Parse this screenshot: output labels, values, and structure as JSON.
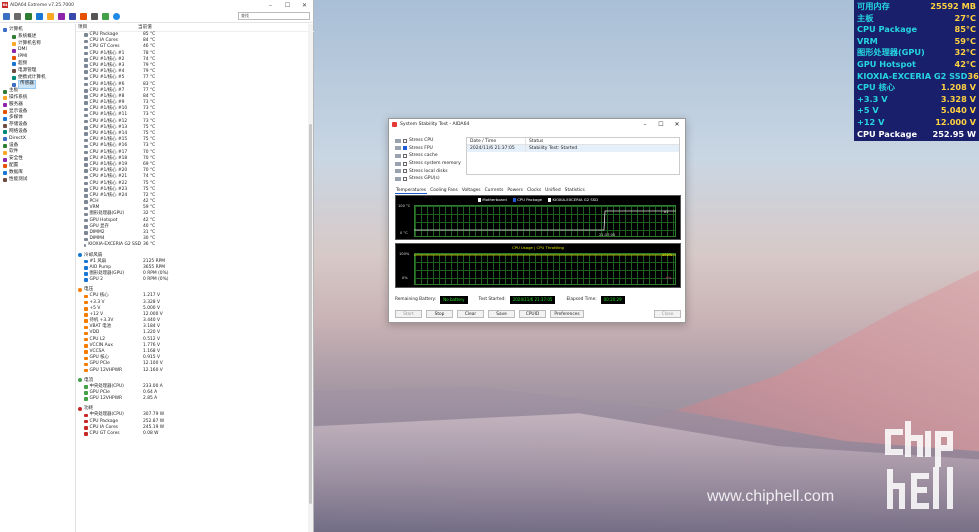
{
  "desktop": {
    "watermark": "www.chiphell.com"
  },
  "aida": {
    "title": "AIDA64 Extreme v7.25.7000",
    "search_placeholder": "查找",
    "tree": [
      {
        "label": "计算机",
        "level": 0
      },
      {
        "label": "系统概述",
        "level": 1
      },
      {
        "label": "计算机名称",
        "level": 1
      },
      {
        "label": "DMI",
        "level": 1
      },
      {
        "label": "IPMI",
        "level": 1
      },
      {
        "label": "超频",
        "level": 1
      },
      {
        "label": "电源管理",
        "level": 1
      },
      {
        "label": "便携式计算机",
        "level": 1
      },
      {
        "label": "传感器",
        "level": 1,
        "selected": true
      },
      {
        "label": "主板",
        "level": 0
      },
      {
        "label": "操作系统",
        "level": 0
      },
      {
        "label": "服务器",
        "level": 0
      },
      {
        "label": "显示设备",
        "level": 0
      },
      {
        "label": "多媒体",
        "level": 0
      },
      {
        "label": "存储设备",
        "level": 0
      },
      {
        "label": "网络设备",
        "level": 0
      },
      {
        "label": "DirectX",
        "level": 0
      },
      {
        "label": "设备",
        "level": 0
      },
      {
        "label": "软件",
        "level": 0
      },
      {
        "label": "安全性",
        "level": 0
      },
      {
        "label": "配置",
        "level": 0
      },
      {
        "label": "数据库",
        "level": 0
      },
      {
        "label": "性能测试",
        "level": 0
      }
    ],
    "col_item": "项目",
    "col_value": "当前值",
    "temps": [
      [
        "CPU Package",
        "85 °C"
      ],
      [
        "CPU IA Cores",
        "84 °C"
      ],
      [
        "CPU GT Cores",
        "46 °C"
      ],
      [
        "CPU #1/核心 #1",
        "78 °C"
      ],
      [
        "CPU #1/核心 #2",
        "74 °C"
      ],
      [
        "CPU #1/核心 #3",
        "79 °C"
      ],
      [
        "CPU #1/核心 #4",
        "79 °C"
      ],
      [
        "CPU #1/核心 #5",
        "77 °C"
      ],
      [
        "CPU #1/核心 #6",
        "83 °C"
      ],
      [
        "CPU #1/核心 #7",
        "77 °C"
      ],
      [
        "CPU #1/核心 #8",
        "84 °C"
      ],
      [
        "CPU #1/核心 #9",
        "73 °C"
      ],
      [
        "CPU #1/核心 #10",
        "73 °C"
      ],
      [
        "CPU #1/核心 #11",
        "73 °C"
      ],
      [
        "CPU #1/核心 #12",
        "73 °C"
      ],
      [
        "CPU #1/核心 #13",
        "75 °C"
      ],
      [
        "CPU #1/核心 #14",
        "75 °C"
      ],
      [
        "CPU #1/核心 #15",
        "75 °C"
      ],
      [
        "CPU #1/核心 #16",
        "73 °C"
      ],
      [
        "CPU #1/核心 #17",
        "70 °C"
      ],
      [
        "CPU #1/核心 #18",
        "70 °C"
      ],
      [
        "CPU #1/核心 #19",
        "69 °C"
      ],
      [
        "CPU #1/核心 #20",
        "70 °C"
      ],
      [
        "CPU #1/核心 #21",
        "74 °C"
      ],
      [
        "CPU #1/核心 #22",
        "75 °C"
      ],
      [
        "CPU #1/核心 #23",
        "75 °C"
      ],
      [
        "CPU #1/核心 #24",
        "72 °C"
      ],
      [
        "PCH",
        "42 °C"
      ],
      [
        "VRM",
        "59 °C"
      ],
      [
        "图形处理器(GPU)",
        "32 °C"
      ],
      [
        "GPU Hotspot",
        "42 °C"
      ],
      [
        "GPU 显存",
        "40 °C"
      ],
      [
        "DIMM2",
        "31 °C"
      ],
      [
        "DIMM4",
        "30 °C"
      ],
      [
        "KIOXIA-EXCERIA G2 SSD",
        "36 °C"
      ]
    ],
    "fans_title": "冷却风扇",
    "fans": [
      [
        "#1 风扇",
        "2125 RPM"
      ],
      [
        "AIO Pump",
        "3655 RPM"
      ],
      [
        "图形处理器(GPU)",
        "0 RPM (0%)"
      ],
      [
        "GPU 2",
        "0 RPM (0%)"
      ]
    ],
    "volt_title": "电压",
    "volts": [
      [
        "CPU 核心",
        "1.217 V"
      ],
      [
        "+3.3 V",
        "3.328 V"
      ],
      [
        "+5 V",
        "5.000 V"
      ],
      [
        "+12 V",
        "12.000 V"
      ],
      [
        "待机 +3.3V",
        "3.440 V"
      ],
      [
        "VBAT 电池",
        "3.184 V"
      ],
      [
        "VDD",
        "1.220 V"
      ],
      [
        "CPU L2",
        "0.512 V"
      ],
      [
        "VCCIN Aux",
        "1.776 V"
      ],
      [
        "VCCSA",
        "1.168 V"
      ],
      [
        "GPU 核心",
        "0.915 V"
      ],
      [
        "GPU PCIe",
        "12.100 V"
      ],
      [
        "GPU 12VHPWR",
        "12.160 V"
      ]
    ],
    "curr_title": "电流",
    "currents": [
      [
        "中央处理器(CPU)",
        "233.00 A"
      ],
      [
        "GPU PCIe",
        "0.64 A"
      ],
      [
        "GPU 12VHPWR",
        "2.85 A"
      ]
    ],
    "power_title": "功耗",
    "powers": [
      [
        "中央处理器(CPU)",
        "307.79 W"
      ],
      [
        "CPU Package",
        "252.87 W"
      ],
      [
        "CPU IA Cores",
        "245.19 W"
      ],
      [
        "CPU GT Cores",
        "0.08 W"
      ]
    ]
  },
  "stability": {
    "title": "System Stability Test - AIDA64",
    "stress_items": [
      {
        "label": "Stress CPU",
        "checked": false
      },
      {
        "label": "Stress FPU",
        "checked": true
      },
      {
        "label": "Stress cache",
        "checked": false
      },
      {
        "label": "Stress system memory",
        "checked": false
      },
      {
        "label": "Stress local disks",
        "checked": false
      },
      {
        "label": "Stress GPU(s)",
        "checked": false
      }
    ],
    "log_headers": [
      "Date / Time",
      "Status"
    ],
    "log_row": [
      "2024/11/6 21:37:05",
      "Stability Test: Started"
    ],
    "tabs": [
      "Temperatures",
      "Cooling Fans",
      "Voltages",
      "Currents",
      "Powers",
      "Clocks",
      "Unified",
      "Statistics"
    ],
    "graph1": {
      "legend": [
        "Motherboard",
        "CPU Package",
        "KIOXIA-EXCERIA G2 SSD"
      ],
      "y_top": "100 °C",
      "y_bottom": "0 °C",
      "time": "21:37:05",
      "value": "85"
    },
    "graph2": {
      "legend": "CPU Usage  |  CPU Throttling",
      "y_top": "100%",
      "y_bottom": "0%",
      "value_top": "100%",
      "value_bottom": "0%"
    },
    "remaining_label": "Remaining Battery:",
    "remaining_value": "No battery",
    "started_label": "Test Started:",
    "started_value": "2024/11/6 21:37:05",
    "elapsed_label": "Elapsed Time:",
    "elapsed_value": "00:20:29",
    "buttons": {
      "start": "Start",
      "stop": "Stop",
      "clear": "Clear",
      "save": "Save",
      "cpuid": "CPUID",
      "preferences": "Preferences",
      "close": "Close"
    }
  },
  "osd": [
    {
      "k": "可用内存",
      "v": "25592 MB"
    },
    {
      "k": "主板",
      "v": "27°C"
    },
    {
      "k": "CPU Package",
      "v": "85°C"
    },
    {
      "k": "VRM",
      "v": "59°C"
    },
    {
      "k": "图形处理器(GPU)",
      "v": "32°C"
    },
    {
      "k": "GPU Hotspot",
      "v": "42°C"
    },
    {
      "k": "KIOXIA-EXCERIA G2 SSD",
      "v": "36°C"
    },
    {
      "k": "CPU 核心",
      "v": "1.208 V"
    },
    {
      "k": "+3.3 V",
      "v": "3.328 V"
    },
    {
      "k": "+5 V",
      "v": "5.040 V"
    },
    {
      "k": "+12 V",
      "v": "12.000 V"
    },
    {
      "k": "CPU Package",
      "v": "252.95 W"
    }
  ],
  "colors": {
    "osd_bg": "#1a1f6b",
    "osd_key": "#25d6e0",
    "osd_val": "#ffd23f",
    "lcd": "#27e227"
  }
}
